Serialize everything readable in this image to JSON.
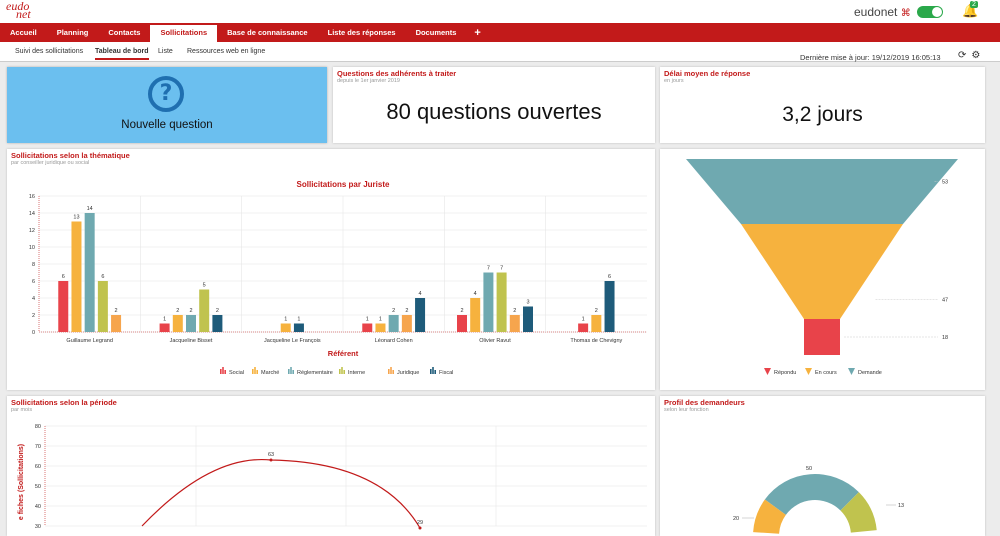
{
  "logo": {
    "line1": "eudo",
    "line2": "net"
  },
  "header": {
    "brand": "eudonet",
    "brand_mark": "⌘",
    "notif_count": "2"
  },
  "nav": {
    "tabs": [
      "Accueil",
      "Planning",
      "Contacts",
      "Sollicitations",
      "Base de connaissance",
      "Liste des réponses",
      "Documents"
    ],
    "active": "Sollicitations",
    "plus": "+"
  },
  "subnav": {
    "tabs": [
      "Suivi des sollicitations",
      "Tableau de bord",
      "Liste",
      "Ressources web en ligne"
    ],
    "active": "Tableau de bord"
  },
  "last_update": "Dernière mise à jour: 19/12/2019 16:05:13",
  "tiles": {
    "new_question": {
      "label": "Nouvelle question",
      "icon": "question-icon"
    },
    "open_questions": {
      "title": "Questions des adhérents à traiter",
      "subtitle": "depuis le 1er janvier 2019",
      "value": "80 questions ouvertes"
    },
    "delay": {
      "title": "Délai moyen de réponse",
      "subtitle": "en jours",
      "value": "3,2 jours"
    }
  },
  "panel_theme": {
    "title": "Sollicitations selon la thématique",
    "subtitle": "par conseiller juridique ou social"
  },
  "panel_period": {
    "title": "Sollicitations selon la période",
    "subtitle": "par mois"
  },
  "panel_profile": {
    "title": "Profil des demandeurs",
    "subtitle": "selon leur fonction"
  },
  "colors": {
    "brand": "#c21a1a",
    "tile_blue": "#6bbfef"
  },
  "chart_data": [
    {
      "type": "bar",
      "title": "Sollicitations par Juriste",
      "xlabel": "Référent",
      "ylim": [
        0,
        16
      ],
      "yticks": [
        0,
        2,
        4,
        6,
        8,
        10,
        12,
        14,
        16
      ],
      "categories": [
        "Guillaume Legrand",
        "Jacqueline Bisset",
        "Jacqueline Le François",
        "Léonard Cohen",
        "Olivier Ravut",
        "Thomas de Chevigny"
      ],
      "series": [
        {
          "name": "Social",
          "color": "#e8434a",
          "values": [
            6,
            1,
            0,
            1,
            2,
            1
          ]
        },
        {
          "name": "Marché",
          "color": "#f6b23e",
          "values": [
            13,
            2,
            1,
            1,
            4,
            2
          ]
        },
        {
          "name": "Réglementaire",
          "color": "#6fa9b0",
          "values": [
            14,
            2,
            0,
            2,
            7,
            0
          ]
        },
        {
          "name": "Interne",
          "color": "#c0c34e",
          "values": [
            6,
            5,
            0,
            0,
            7,
            0
          ]
        },
        {
          "name": "Juridique",
          "color": "#f6a54d",
          "values": [
            2,
            0,
            0,
            2,
            2,
            0
          ]
        },
        {
          "name": "Fiscal",
          "color": "#1e5b7a",
          "values": [
            0,
            2,
            1,
            4,
            3,
            6
          ]
        }
      ],
      "legend": "bottom"
    },
    {
      "type": "funnel",
      "series": [
        {
          "name": "Demande",
          "color": "#6fa9b0",
          "value": 53
        },
        {
          "name": "En cours",
          "color": "#f6b23e",
          "value": 47
        },
        {
          "name": "Répondu",
          "color": "#e8434a",
          "value": 18
        }
      ],
      "legend": "bottom",
      "legend_order": [
        "Répondu",
        "En cours",
        "Demande"
      ]
    },
    {
      "type": "line",
      "ylabel": "e fiches (Sollicitations)",
      "ylim": [
        30,
        80
      ],
      "yticks": [
        30,
        40,
        50,
        60,
        70,
        80
      ],
      "visible_labels": [
        {
          "label": "63",
          "value": 63
        },
        {
          "label": "29",
          "value": 29
        }
      ]
    },
    {
      "type": "pie",
      "visible_labels": [
        "50",
        "13",
        "20"
      ]
    }
  ]
}
